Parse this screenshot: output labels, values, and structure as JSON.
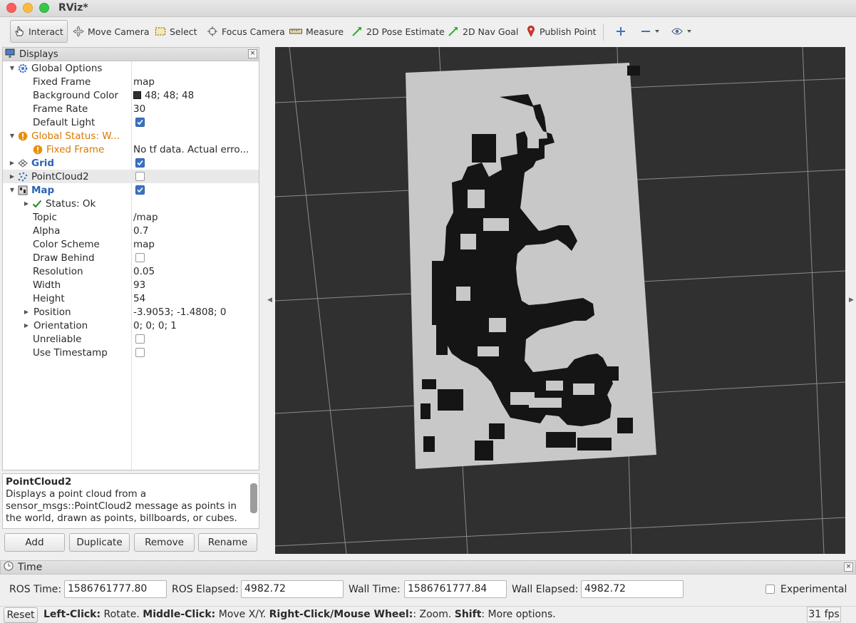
{
  "window": {
    "title": "RViz*"
  },
  "toolbar": {
    "interact": "Interact",
    "move_camera": "Move Camera",
    "select": "Select",
    "focus_camera": "Focus Camera",
    "measure": "Measure",
    "pose_estimate": "2D Pose Estimate",
    "nav_goal": "2D Nav Goal",
    "publish_point": "Publish Point"
  },
  "displays": {
    "title": "Displays",
    "close": "×",
    "rows": [
      {
        "name": "Global Options",
        "value": ""
      },
      {
        "name": "Fixed Frame",
        "value": "map"
      },
      {
        "name": "Background Color",
        "value": "48; 48; 48"
      },
      {
        "name": "Frame Rate",
        "value": "30"
      },
      {
        "name": "Default Light",
        "value": ""
      },
      {
        "name": "Global Status: W...",
        "value": ""
      },
      {
        "name": "Fixed Frame",
        "value": "No tf data.  Actual erro..."
      },
      {
        "name": "Grid",
        "value": ""
      },
      {
        "name": "PointCloud2",
        "value": ""
      },
      {
        "name": "Map",
        "value": ""
      },
      {
        "name": "Status: Ok",
        "value": ""
      },
      {
        "name": "Topic",
        "value": "/map"
      },
      {
        "name": "Alpha",
        "value": "0.7"
      },
      {
        "name": "Color Scheme",
        "value": "map"
      },
      {
        "name": "Draw Behind",
        "value": ""
      },
      {
        "name": "Resolution",
        "value": "0.05"
      },
      {
        "name": "Width",
        "value": "93"
      },
      {
        "name": "Height",
        "value": "54"
      },
      {
        "name": "Position",
        "value": "-3.9053; -1.4808; 0"
      },
      {
        "name": "Orientation",
        "value": "0; 0; 0; 1"
      },
      {
        "name": "Unreliable",
        "value": ""
      },
      {
        "name": "Use Timestamp",
        "value": ""
      }
    ],
    "description": {
      "title": "PointCloud2",
      "text": "Displays a point cloud from a sensor_msgs::PointCloud2 message as points in the world, drawn as points, billboards, or cubes."
    },
    "buttons": {
      "add": "Add",
      "duplicate": "Duplicate",
      "remove": "Remove",
      "rename": "Rename"
    }
  },
  "time": {
    "title": "Time",
    "close": "×",
    "ros_time_label": "ROS Time:",
    "ros_time": "1586761777.80",
    "ros_elapsed_label": "ROS Elapsed:",
    "ros_elapsed": "4982.72",
    "wall_time_label": "Wall Time:",
    "wall_time": "1586761777.84",
    "wall_elapsed_label": "Wall Elapsed:",
    "wall_elapsed": "4982.72",
    "experimental": "Experimental"
  },
  "status": {
    "reset": "Reset",
    "hint_left_click": "Left-Click:",
    "hint_rotate": " Rotate. ",
    "hint_middle_click": "Middle-Click:",
    "hint_move": " Move X/Y. ",
    "hint_right_click": "Right-Click/Mouse Wheel:",
    "hint_zoom": ": Zoom. ",
    "hint_shift": "Shift",
    "hint_more": ": More options.",
    "fps": "31 fps"
  },
  "colors": {
    "background": "#303030",
    "map_free": "#c8c8c8",
    "map_occupied": "#141414",
    "grid": "#a0a0a0"
  }
}
